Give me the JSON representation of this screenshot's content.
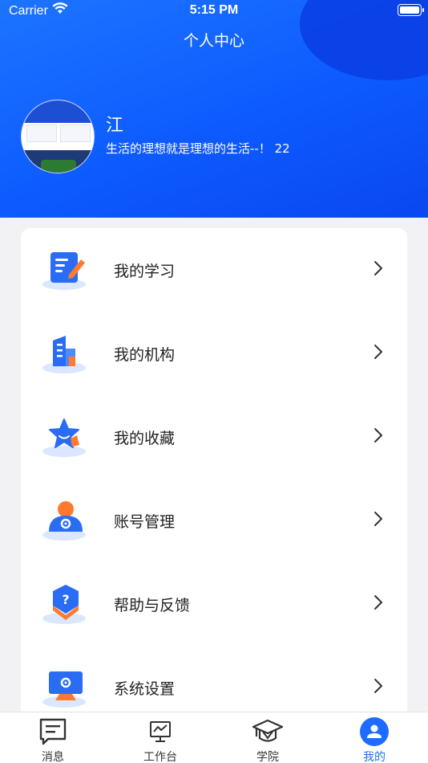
{
  "status_bar": {
    "carrier": "Carrier",
    "time": "5:15 PM"
  },
  "header": {
    "title": "个人中心",
    "username": "江",
    "signature": "生活的理想就是理想的生活--！ 22"
  },
  "menu": {
    "items": [
      {
        "label": "我的学习",
        "icon": "study-document-icon"
      },
      {
        "label": "我的机构",
        "icon": "building-icon"
      },
      {
        "label": "我的收藏",
        "icon": "star-icon"
      },
      {
        "label": "账号管理",
        "icon": "account-gear-icon"
      },
      {
        "label": "帮助与反馈",
        "icon": "help-question-icon"
      },
      {
        "label": "系统设置",
        "icon": "monitor-settings-icon"
      }
    ]
  },
  "tabbar": {
    "tabs": [
      {
        "label": "消息",
        "icon": "message-icon"
      },
      {
        "label": "工作台",
        "icon": "workbench-chart-icon"
      },
      {
        "label": "学院",
        "icon": "graduation-cap-icon"
      },
      {
        "label": "我的",
        "icon": "profile-icon",
        "active": true
      }
    ]
  },
  "colors": {
    "primary": "#1e6cff",
    "header": "#0d5bff",
    "accent_orange": "#ff7a2f"
  }
}
